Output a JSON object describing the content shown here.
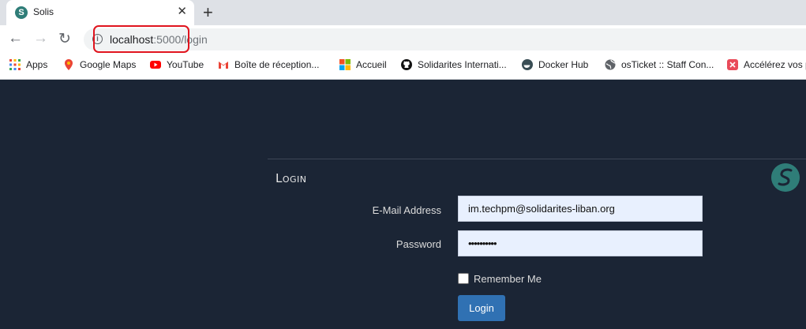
{
  "browser": {
    "tab_title": "Solis",
    "tab_close": "✕",
    "new_tab": "+",
    "url_host": "localhost",
    "url_path": ":5000/login",
    "info_glyph": "i"
  },
  "bookmarks": [
    {
      "label": "Apps",
      "icon": "apps-grid-icon"
    },
    {
      "label": "Google Maps",
      "icon": "google-maps-icon"
    },
    {
      "label": "YouTube",
      "icon": "youtube-icon"
    },
    {
      "label": "Boîte de réception...",
      "icon": "gmail-icon"
    },
    {
      "label": "Accueil",
      "icon": "microsoft-icon"
    },
    {
      "label": "Solidarites Internati...",
      "icon": "github-icon"
    },
    {
      "label": "Docker Hub",
      "icon": "docker-icon"
    },
    {
      "label": "osTicket :: Staff Con...",
      "icon": "globe-icon"
    },
    {
      "label": "Accélérez vos p",
      "icon": "bookmark-app-icon"
    }
  ],
  "login": {
    "title": "Login",
    "email_label": "E-Mail Address",
    "email_value": "im.techpm@solidarites-liban.org",
    "password_label": "Password",
    "password_value": "••••••••••",
    "remember_label": "Remember Me",
    "button_label": "Login"
  },
  "colors": {
    "page_bg": "#1b2535",
    "button_bg": "#3071b3",
    "logo_bg": "#2f7d78",
    "highlight": "#e0141e"
  }
}
